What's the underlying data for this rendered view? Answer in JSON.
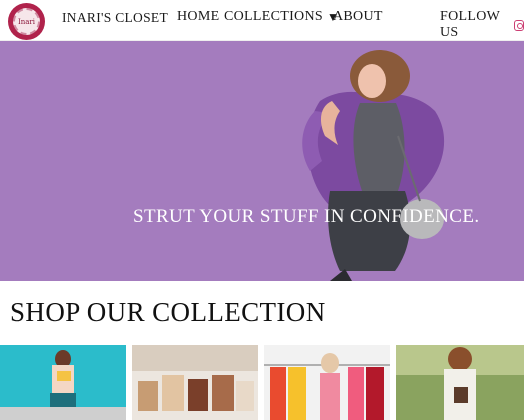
{
  "brand": {
    "name": "INARI'S CLOSET",
    "logo_text": "Inari"
  },
  "nav": {
    "home": "HOME",
    "collections": "COLLECTIONS",
    "about": "ABOUT",
    "follow": "FOLLOW US"
  },
  "icons": {
    "caret": "caret-down-icon",
    "social": "instagram-icon"
  },
  "hero": {
    "headline": "STRUT YOUR STUFF IN CONFIDENCE."
  },
  "shop": {
    "title": "SHOP OUR COLLECTION"
  },
  "colors": {
    "hero_purple": "#a67cbf",
    "brand_maroon": "#b0224b",
    "instagram": "#cc3f73"
  }
}
